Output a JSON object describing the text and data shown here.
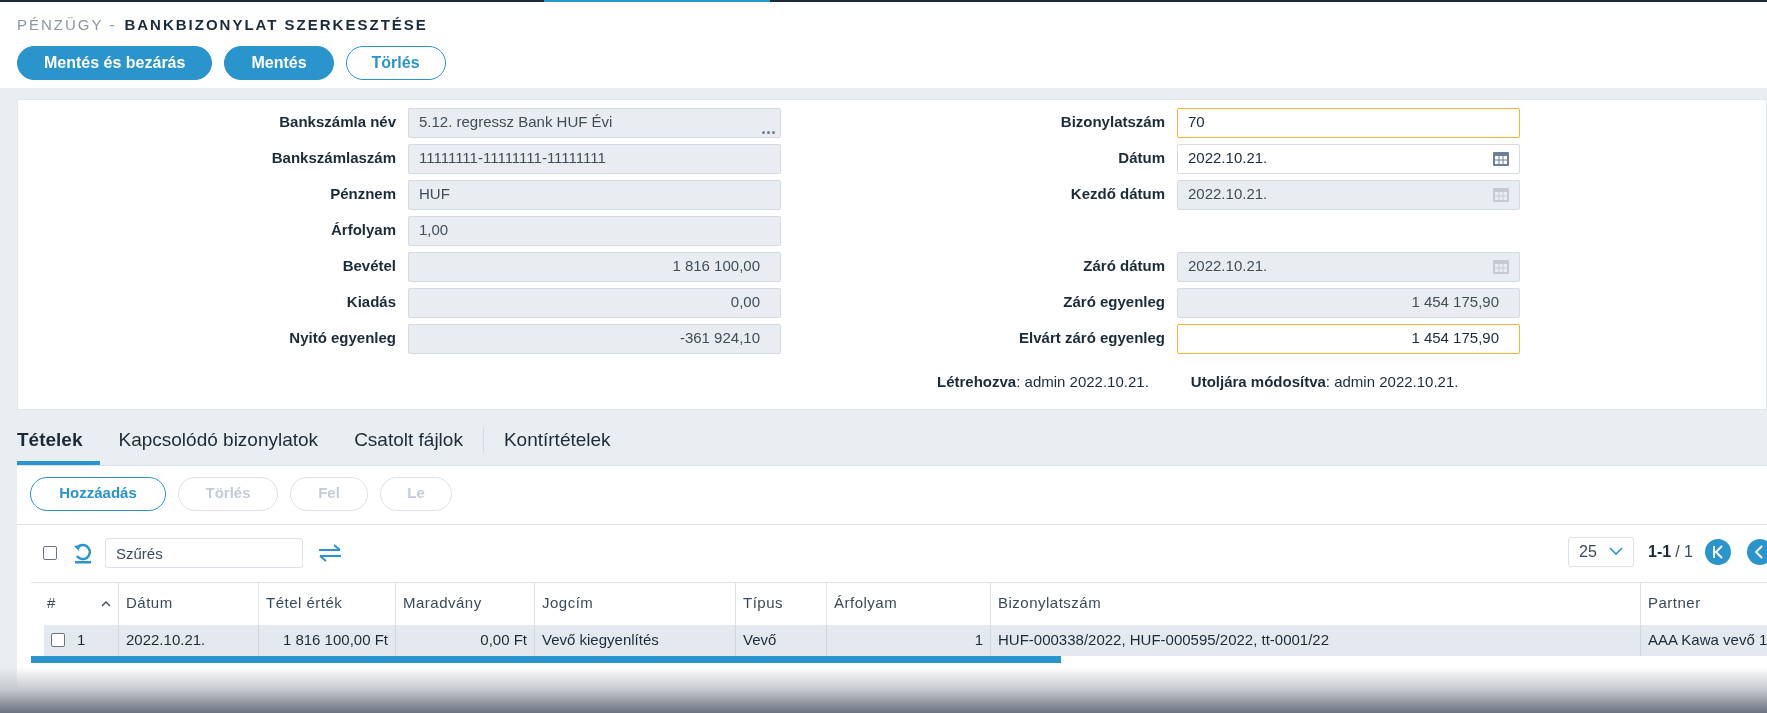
{
  "header": {
    "section": "PÉNZÜGY -",
    "title": "BANKBIZONYLAT SZERKESZTÉSE"
  },
  "actions": [
    {
      "label": "Mentés és bezárás",
      "kind": "primary"
    },
    {
      "label": "Mentés",
      "kind": "primary"
    },
    {
      "label": "Törlés",
      "kind": "outline"
    }
  ],
  "form": {
    "rows": [
      {
        "left": {
          "label": "Bankszámla név",
          "value": "5.12. regressz Bank HUF Évi",
          "kind": "lookup",
          "disabled": true
        },
        "right": {
          "label": "Bizonylatszám",
          "value": "70",
          "kind": "text",
          "disabled": false,
          "required": true
        }
      },
      {
        "left": {
          "label": "Bankszámlaszám",
          "value": "11111111-11111111-11111111",
          "kind": "text",
          "disabled": true
        },
        "right": {
          "label": "Dátum",
          "value": "2022.10.21.",
          "kind": "date",
          "disabled": false,
          "required": false
        }
      },
      {
        "left": {
          "label": "Pénznem",
          "value": "HUF",
          "kind": "text",
          "disabled": true
        },
        "right": {
          "label": "Kezdő dátum",
          "value": "2022.10.21.",
          "kind": "date",
          "disabled": true,
          "required": false
        }
      },
      {
        "left": {
          "label": "Árfolyam",
          "value": "1,00",
          "kind": "text",
          "disabled": true
        }
      },
      {
        "left": {
          "label": "Bevétel",
          "value": "1 816 100,00",
          "kind": "number",
          "disabled": true
        },
        "right": {
          "label": "Záró dátum",
          "value": "2022.10.21.",
          "kind": "date",
          "disabled": true,
          "required": false
        }
      },
      {
        "left": {
          "label": "Kiadás",
          "value": "0,00",
          "kind": "number",
          "disabled": true
        },
        "right": {
          "label": "Záró egyenleg",
          "value": "1 454 175,90",
          "kind": "number",
          "disabled": true,
          "required": false
        }
      },
      {
        "left": {
          "label": "Nyitó egyenleg",
          "value": "-361 924,10",
          "kind": "number",
          "disabled": true
        },
        "right": {
          "label": "Elvárt záró egyenleg",
          "value": "1 454 175,90",
          "kind": "number",
          "disabled": false,
          "required": true
        }
      }
    ],
    "meta": [
      "**Létrehozva**: admin 2022.10.21.",
      "**Utoljára módosítva**: admin 2022.10.21."
    ]
  },
  "tabs": [
    {
      "label": "Tételek",
      "selected": true
    },
    {
      "label": "Kapcsolódó bizonylatok",
      "selected": false
    },
    {
      "label": "Csatolt fájlok",
      "selected": false
    },
    {
      "label": "Kontírtételek",
      "selected": false
    }
  ],
  "toolbar": [
    {
      "label": "Hozzáadás",
      "disabled": false
    },
    {
      "label": "Törlés",
      "disabled": true
    },
    {
      "label": "Fel",
      "disabled": true
    },
    {
      "label": "Le",
      "disabled": true
    }
  ],
  "filter": {
    "select_all": false,
    "placeholder": "Szűrés"
  },
  "pagination": {
    "page_size": "25",
    "range": "1-1",
    "total": "/ 1"
  },
  "table": {
    "columns": [
      {
        "label": "#",
        "kind": "index",
        "sorted": true
      },
      {
        "label": "Dátum",
        "kind": "text"
      },
      {
        "label": "Tétel érték",
        "kind": "number"
      },
      {
        "label": "Maradvány",
        "kind": "number"
      },
      {
        "label": "Jogcím",
        "kind": "text"
      },
      {
        "label": "Típus",
        "kind": "text"
      },
      {
        "label": "Árfolyam",
        "kind": "number"
      },
      {
        "label": "Bizonylatszám",
        "kind": "text"
      },
      {
        "label": "Partner",
        "kind": "text"
      }
    ],
    "rows": [
      {
        "checked": false,
        "cells": [
          "1",
          "2022.10.21.",
          "1 816 100,00 Ft",
          "0,00 Ft",
          "Vevő kiegyenlítés",
          "Vevő",
          "1",
          "HUF-000338/2022, HUF-000595/2022, tt-0001/22",
          "AAA Kawa vevő 1"
        ]
      }
    ]
  }
}
